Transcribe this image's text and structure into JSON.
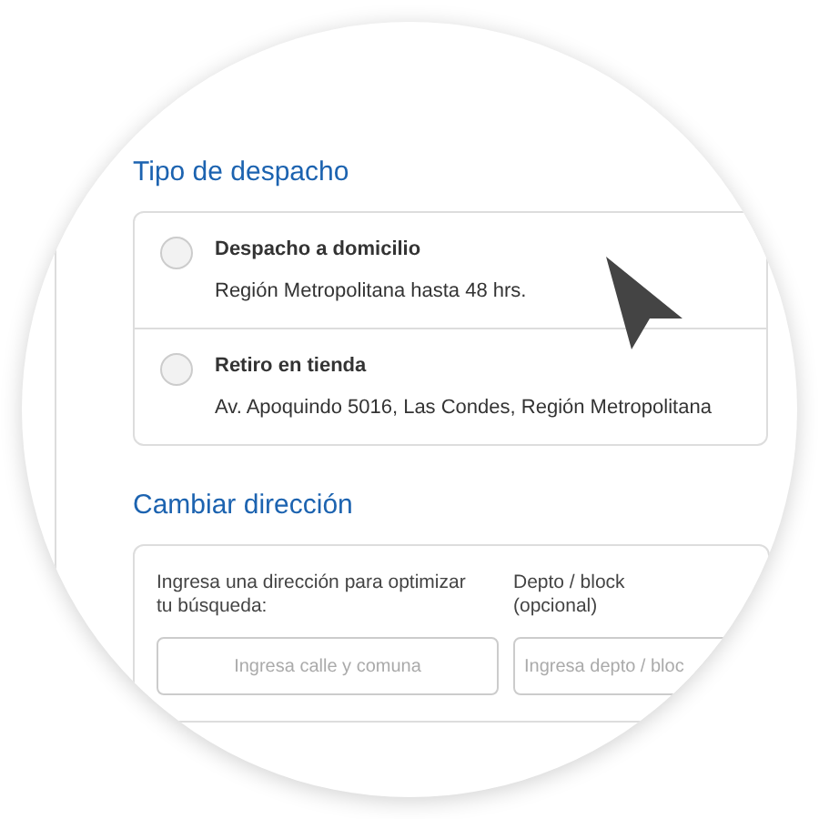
{
  "shipping": {
    "title": "Tipo de despacho",
    "options": [
      {
        "title": "Despacho a domicilio",
        "detail": "Región Metropolitana hasta 48 hrs.",
        "selected": false
      },
      {
        "title": "Retiro en tienda",
        "detail": "Av. Apoquindo 5016, Las Condes, Región Metropolitana",
        "selected": false
      }
    ]
  },
  "address": {
    "title": "Cambiar dirección",
    "fields": [
      {
        "label": "Ingresa una dirección para optimizar tu búsqueda:",
        "placeholder": "Ingresa calle y comuna"
      },
      {
        "label": "Depto / block (opcional)",
        "placeholder": "Ingresa depto / bloc"
      }
    ]
  }
}
